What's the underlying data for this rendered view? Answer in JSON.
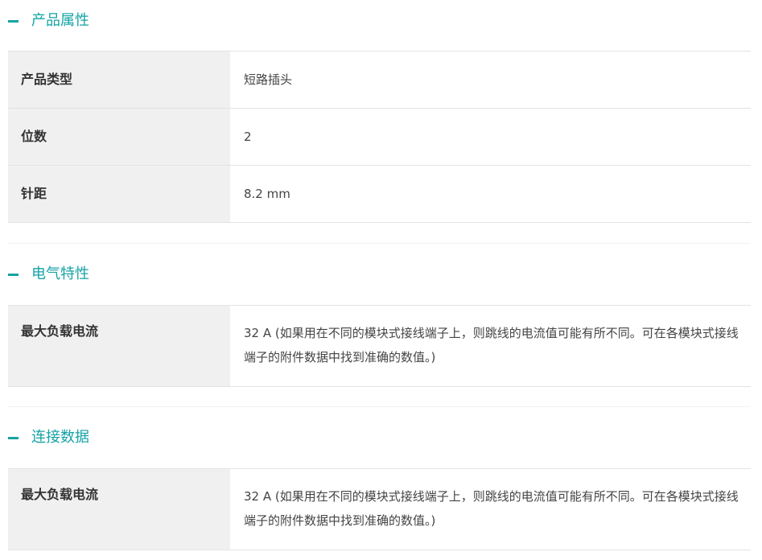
{
  "sections": [
    {
      "title": "产品属性",
      "rows": [
        {
          "label": "产品类型",
          "value": "短路插头"
        },
        {
          "label": "位数",
          "value": "2"
        },
        {
          "label": "针距",
          "value": "8.2 mm"
        }
      ]
    },
    {
      "title": "电气特性",
      "rows": [
        {
          "label": "最大负载电流",
          "value": "32 A (如果用在不同的模块式接线端子上，则跳线的电流值可能有所不同。可在各模块式接线端子的附件数据中找到准确的数值。)"
        }
      ]
    },
    {
      "title": "连接数据",
      "rows": [
        {
          "label": "最大负载电流",
          "value": "32 A (如果用在不同的模块式接线端子上，则跳线的电流值可能有所不同。可在各模块式接线端子的附件数据中找到准确的数值。)"
        }
      ]
    }
  ],
  "colors": {
    "accent": "#16a3a5",
    "label_bg": "#f0f0f0",
    "border": "#e3e3e3"
  },
  "icons": {
    "collapse": "minus-icon"
  }
}
